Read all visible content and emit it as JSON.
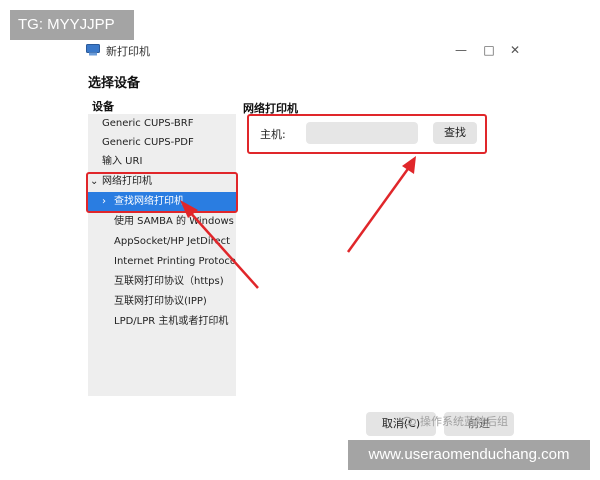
{
  "watermarks": {
    "top_left": "TG: MYYJJPP",
    "bottom_right": "www.useraomenduchang.com",
    "source_overlay": "操作系统蓝效后组"
  },
  "window": {
    "title": "新打印机",
    "icon": "printer-icon",
    "controls": {
      "minimize": "—",
      "maximize": "□",
      "close": "✕"
    }
  },
  "dialog": {
    "section_title": "选择设备",
    "left_header": "设备",
    "devices": [
      {
        "label": "Generic CUPS-BRF",
        "prefix": ""
      },
      {
        "label": "Generic CUPS-PDF",
        "prefix": ""
      },
      {
        "label": "输入 URI",
        "prefix": ""
      },
      {
        "label": "网络打印机",
        "prefix": "⌄"
      },
      {
        "label": "查找网络打印机",
        "prefix": "›"
      },
      {
        "label": "使用 SAMBA 的 Windows 打",
        "prefix": ""
      },
      {
        "label": "AppSocket/HP JetDirect",
        "prefix": ""
      },
      {
        "label": "Internet Printing Protocol",
        "prefix": ""
      },
      {
        "label": "互联网打印协议（https)",
        "prefix": ""
      },
      {
        "label": "互联网打印协议(IPP)",
        "prefix": ""
      },
      {
        "label": "LPD/LPR 主机或者打印机",
        "prefix": ""
      }
    ],
    "right_header": "网络打印机",
    "host_label": "主机:",
    "host_value": "",
    "find_button": "查找",
    "cancel_button": "取消(C)",
    "ok_button": "前进"
  },
  "colors": {
    "selection": "#2a7de1",
    "annotation_red": "#e0262a",
    "panel_bg": "#eeeeee",
    "watermark_bg": "#a4a4a4"
  }
}
